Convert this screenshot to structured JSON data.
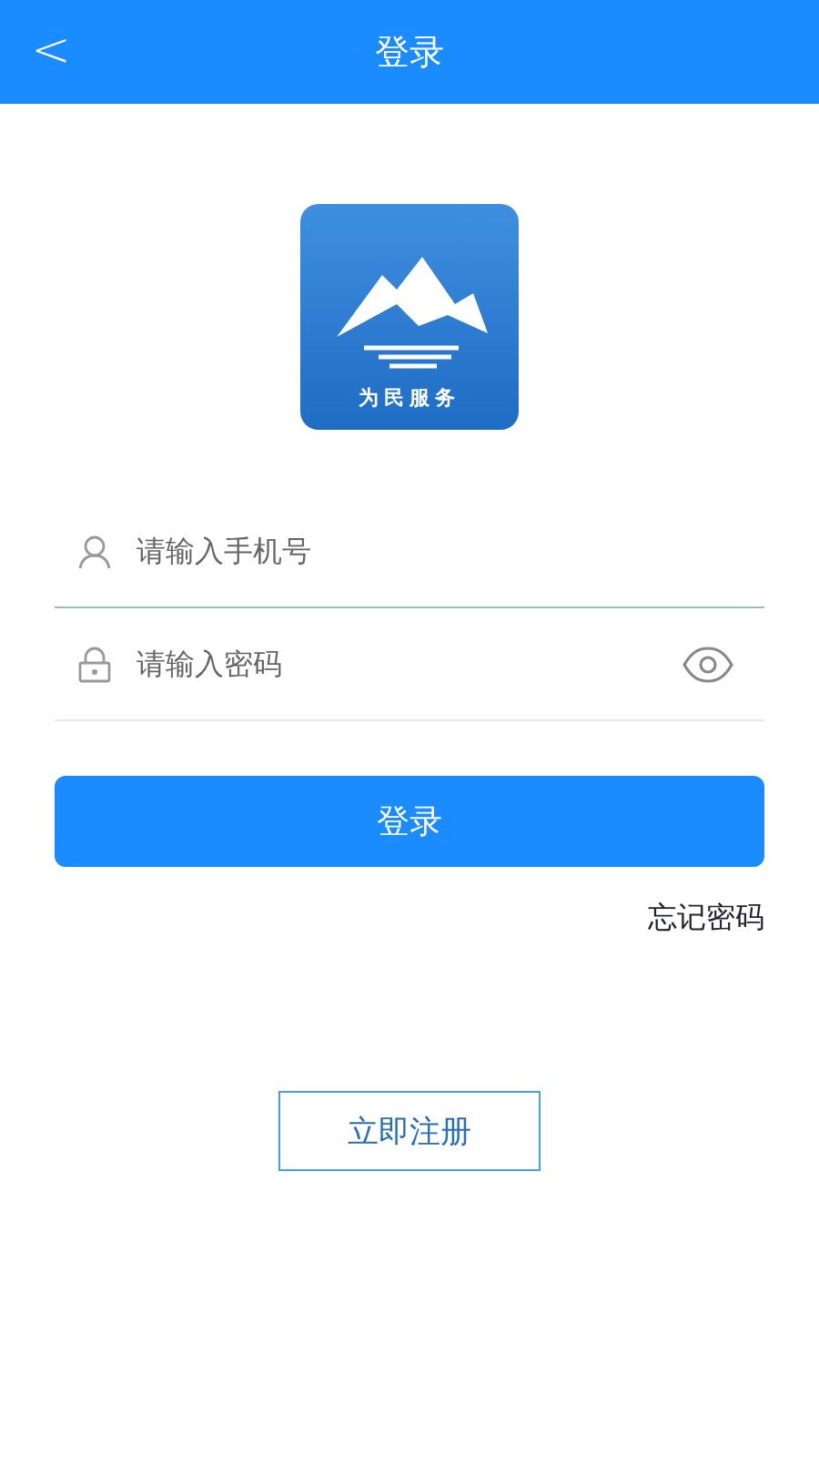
{
  "header": {
    "back": "<",
    "title": "登录"
  },
  "logo": {
    "caption": "为民服务"
  },
  "fields": [
    {
      "kind": "phone",
      "placeholder": "请输入手机号",
      "focused": true
    },
    {
      "kind": "password",
      "placeholder": "请输入密码",
      "focused": false
    }
  ],
  "login_button": "登录",
  "forgot_link": "忘记密码",
  "register_button": "立即注册"
}
